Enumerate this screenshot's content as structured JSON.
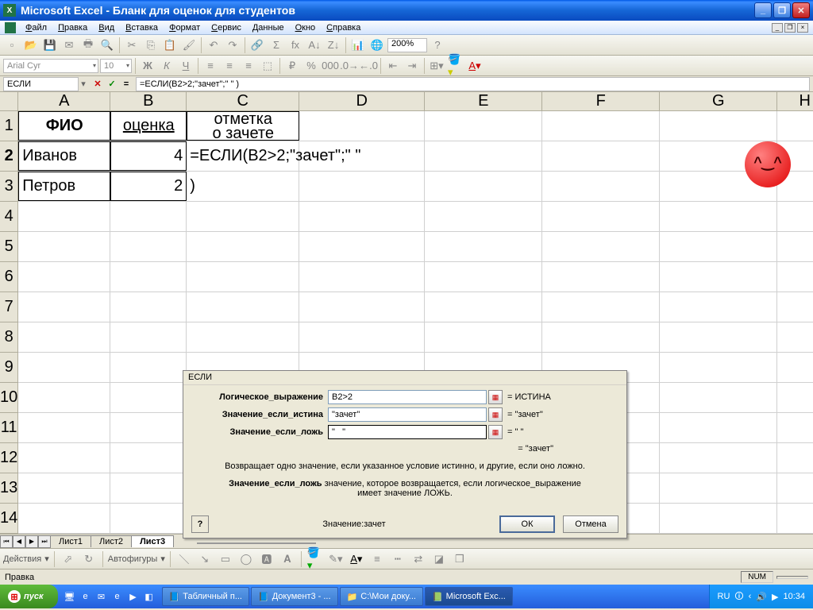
{
  "title": "Microsoft Excel - Бланк для оценок для студентов",
  "menus": [
    "Файл",
    "Правка",
    "Вид",
    "Вставка",
    "Формат",
    "Сервис",
    "Данные",
    "Окно",
    "Справка"
  ],
  "zoom": "200%",
  "font_name": "Arial Cyr",
  "font_size": "10",
  "name_box": "ЕСЛИ",
  "formula": "=ЕСЛИ(B2>2;\"зачет\";\"   \"                                                                        )",
  "columns": [
    {
      "l": "A",
      "w": 116
    },
    {
      "l": "B",
      "w": 96
    },
    {
      "l": "C",
      "w": 142
    },
    {
      "l": "D",
      "w": 158
    },
    {
      "l": "E",
      "w": 148
    },
    {
      "l": "F",
      "w": 148
    },
    {
      "l": "G",
      "w": 148
    },
    {
      "l": "H",
      "w": 70
    }
  ],
  "rows": [
    "1",
    "2",
    "3",
    "4",
    "5",
    "6",
    "7",
    "8",
    "9",
    "10",
    "11",
    "12",
    "13",
    "14"
  ],
  "cells": {
    "A1": "ФИО",
    "B1": "оценка",
    "C1_top": "отметка",
    "C1_bot": "о зачете",
    "A2": "Иванов",
    "B2": "4",
    "C2": "=ЕСЛИ(B2>2;\"зачет\";\"   \"",
    "A3": "Петров",
    "B3": "2",
    "C3": ")"
  },
  "sheets": [
    "Лист1",
    "Лист2",
    "Лист3"
  ],
  "active_sheet": "Лист3",
  "draw_label": "Действия",
  "autoshapes": "Автофигуры",
  "status": "Правка",
  "status_num": "NUM",
  "dialog": {
    "title": "ЕСЛИ",
    "row1_label": "Логическое_выражение",
    "row1_val": "B2>2",
    "row1_res": "= ИСТИНА",
    "row2_label": "Значение_если_истина",
    "row2_val": "\"зачет\"",
    "row2_res": "= \"зачет\"",
    "row3_label": "Значение_если_ложь",
    "row3_val": "\"   \"",
    "row3_res": "= \"   \"",
    "preview": "= \"зачет\"",
    "desc": "Возвращает одно значение, если указанное условие истинно, и другие, если оно ложно.",
    "hint_b": "Значение_если_ложь",
    "hint": " значение, которое возвращается, если логическое_выражение имеет значение ЛОЖЬ.",
    "value_label": "Значение:",
    "value": "зачет",
    "ok": "ОК",
    "cancel": "Отмена"
  },
  "taskbar": {
    "start": "пуск",
    "items": [
      "Табличный п...",
      "Документ3 - ...",
      "C:\\Мои доку...",
      "Microsoft Exc..."
    ],
    "lang": "RU",
    "time": "10:34"
  }
}
